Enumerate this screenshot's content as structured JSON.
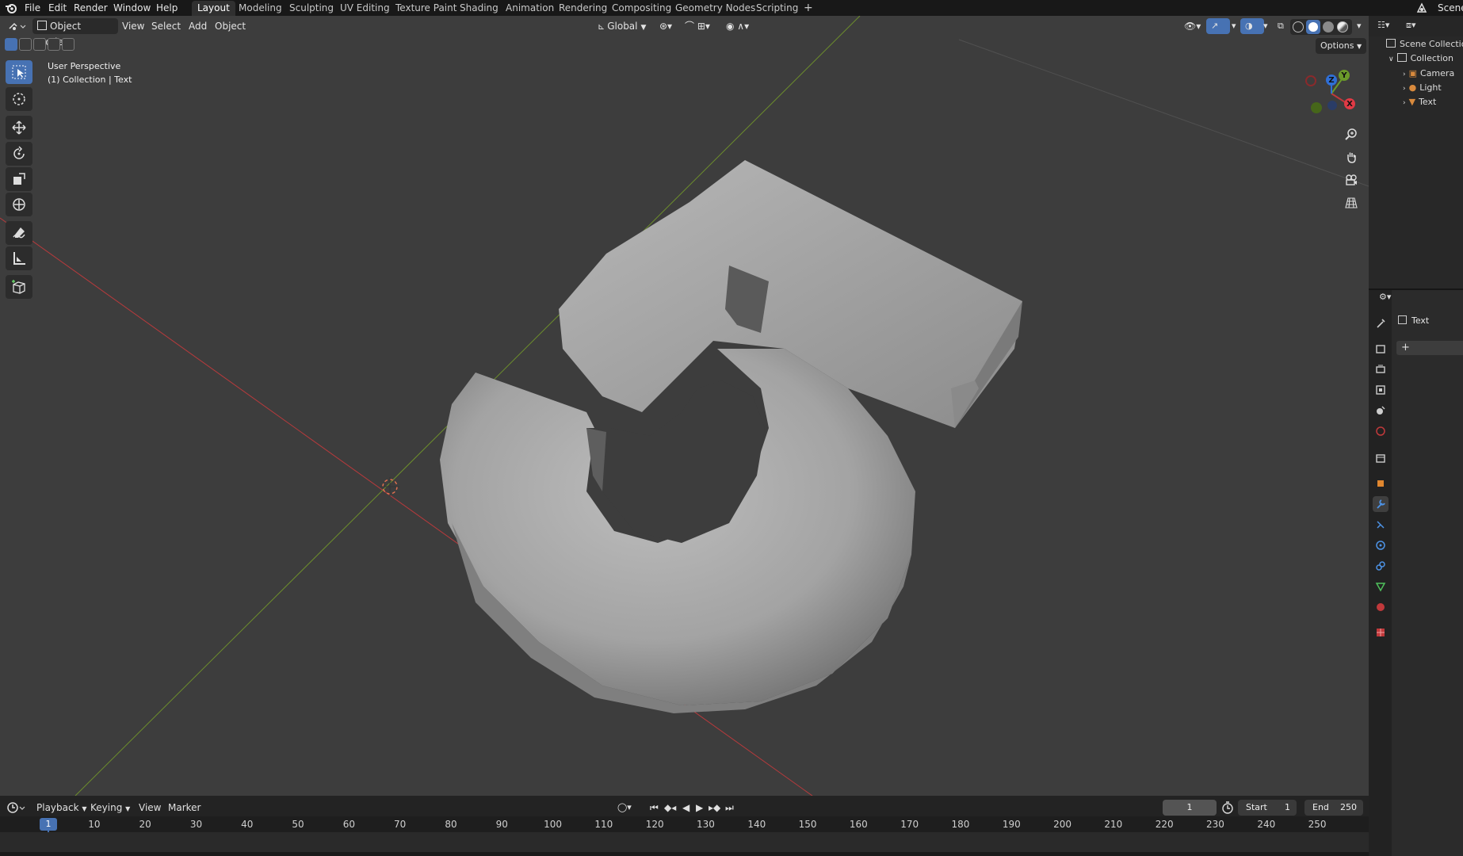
{
  "menu": {
    "file": "File",
    "edit": "Edit",
    "render": "Render",
    "window": "Window",
    "help": "Help"
  },
  "workspaces": [
    "Layout",
    "Modeling",
    "Sculpting",
    "UV Editing",
    "Texture Paint",
    "Shading",
    "Animation",
    "Rendering",
    "Compositing",
    "Geometry Nodes",
    "Scripting"
  ],
  "scene_label": "Scene",
  "viewport_header": {
    "mode": "Object Mode",
    "view": "View",
    "select": "Select",
    "add": "Add",
    "object": "Object",
    "transform_orientation": "Global",
    "options": "Options"
  },
  "viewport_info": {
    "perspective": "User Perspective",
    "collection_line": "(1) Collection | Text"
  },
  "gizmo": {
    "x": "X",
    "y": "Y",
    "z": "Z"
  },
  "outliner": {
    "scene_collection": "Scene Collection",
    "collection": "Collection",
    "items": [
      "Camera",
      "Light",
      "Text"
    ]
  },
  "properties": {
    "object_name": "Text",
    "add_symbol": "+"
  },
  "timeline": {
    "playback": "Playback",
    "keying": "Keying",
    "view": "View",
    "marker": "Marker",
    "current_frame": "1",
    "start_label": "Start",
    "start_value": "1",
    "end_label": "End",
    "end_value": "250",
    "ticks": [
      "10",
      "20",
      "30",
      "40",
      "50",
      "60",
      "70",
      "80",
      "90",
      "100",
      "110",
      "120",
      "130",
      "140",
      "150",
      "160",
      "170",
      "180",
      "190",
      "200",
      "210",
      "220",
      "230",
      "240",
      "250"
    ],
    "playhead_frame": "1"
  },
  "colors": {
    "accent": "#4772b3",
    "x_axis": "#c0393b",
    "y_axis": "#6b9a2a",
    "z_axis": "#2f6fd6",
    "viewport_bg": "#3d3d3d"
  }
}
